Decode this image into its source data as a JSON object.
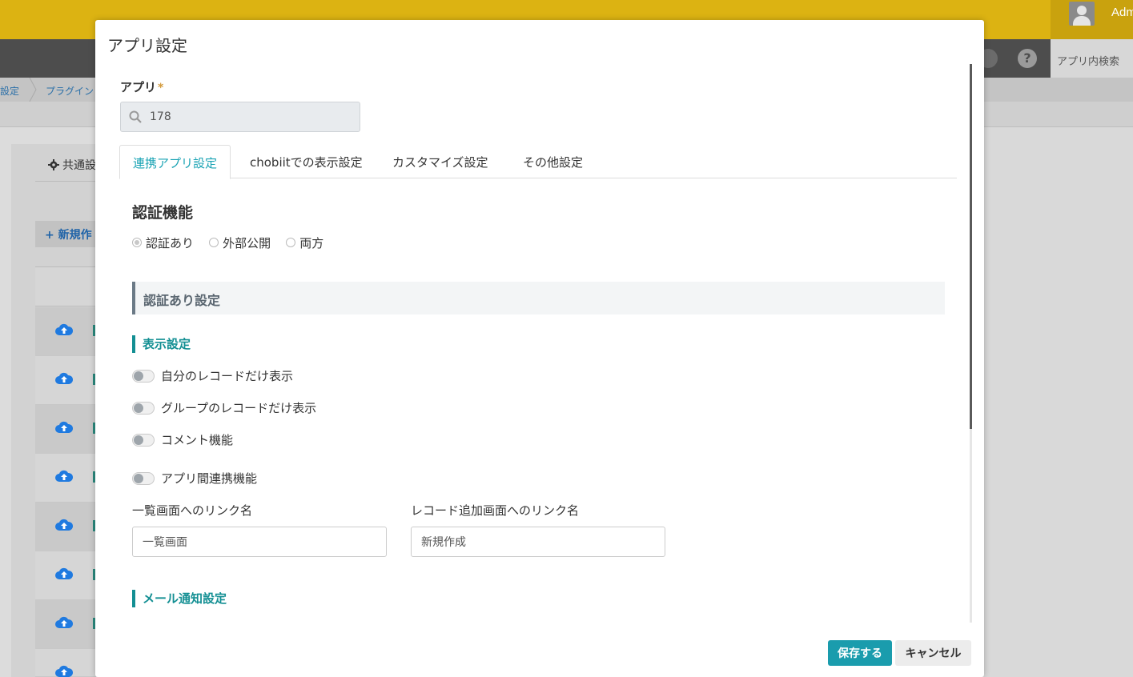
{
  "background": {
    "header": {
      "username": "Adm"
    },
    "toolbar": {
      "search_label": "アプリ内検索"
    },
    "breadcrumb": [
      "設定",
      "プラグイン"
    ],
    "panel": {
      "common_label": "共通設",
      "new_button": "+ 新規作"
    }
  },
  "modal": {
    "title": "アプリ設定",
    "app_field": {
      "label": "アプリ",
      "required_mark": "*",
      "value": "178"
    },
    "tabs": [
      {
        "label": "連携アプリ設定",
        "active": true
      },
      {
        "label": "chobiitでの表示設定",
        "active": false
      },
      {
        "label": "カスタマイズ設定",
        "active": false
      },
      {
        "label": "その他設定",
        "active": false
      }
    ],
    "auth": {
      "title": "認証機能",
      "options": [
        {
          "label": "認証あり",
          "selected": true
        },
        {
          "label": "外部公開",
          "selected": false
        },
        {
          "label": "両方",
          "selected": false
        }
      ]
    },
    "auth_settings_header": "認証あり設定",
    "display_settings": {
      "title": "表示設定",
      "toggles": [
        {
          "label": "自分のレコードだけ表示",
          "on": false
        },
        {
          "label": "グループのレコードだけ表示",
          "on": false
        },
        {
          "label": "コメント機能",
          "on": false
        },
        {
          "label": "アプリ間連携機能",
          "on": false
        }
      ]
    },
    "links": {
      "list_label": "一覧画面へのリンク名",
      "list_value": "一覧画面",
      "add_label": "レコード追加画面へのリンク名",
      "add_value": "新規作成"
    },
    "mail_settings_title": "メール通知設定",
    "buttons": {
      "save": "保存する",
      "cancel": "キャンセル"
    }
  },
  "colors": {
    "header": "#dcb312",
    "toolbar": "#4d4d4d",
    "accent_teal": "#1a9cad",
    "group_title": "#138f93"
  }
}
